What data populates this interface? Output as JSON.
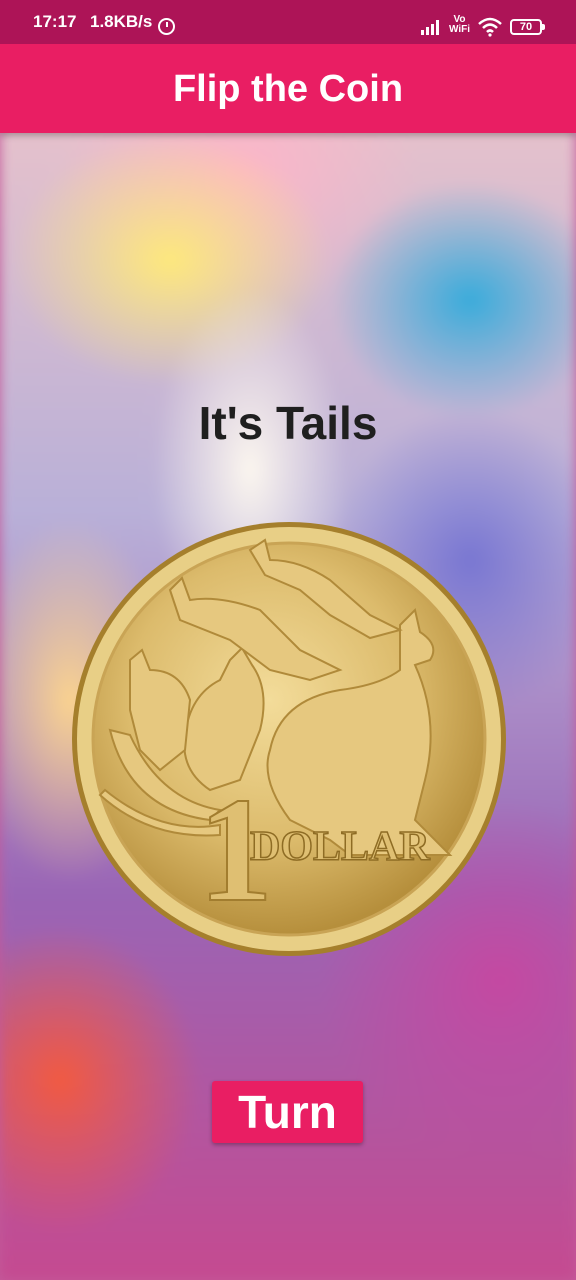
{
  "status_bar": {
    "time": "17:17",
    "network_speed": "1.8KB/s",
    "vowifi_top": "Vo",
    "vowifi_bottom": "WiFi",
    "battery": "70"
  },
  "app_bar": {
    "title": "Flip the Coin"
  },
  "main": {
    "result": "It's Tails",
    "coin": {
      "icon": "dollar-coin-kangaroos-icon",
      "numeral": "1",
      "text": "DOLLAR"
    },
    "turn_button": "Turn"
  },
  "colors": {
    "status_bar": "#ad1457",
    "accent": "#e91e63",
    "coin_gold": "#d9b566"
  }
}
